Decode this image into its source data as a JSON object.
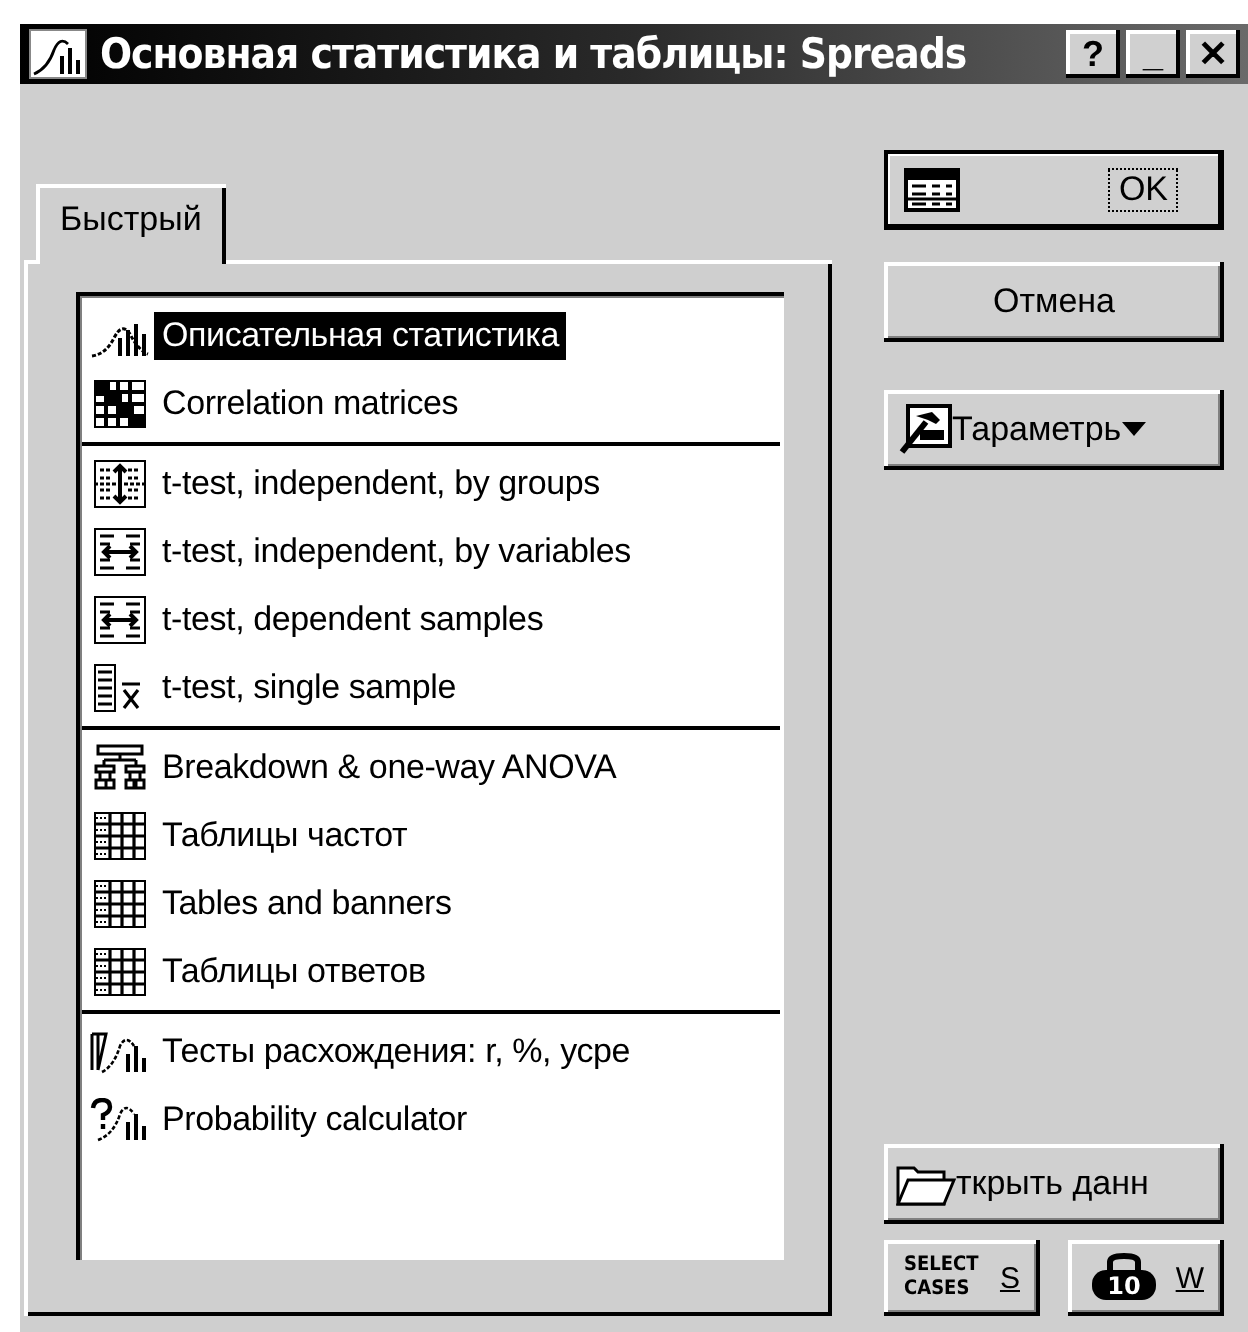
{
  "window": {
    "title": "Основная статистика и таблицы: Spreads",
    "controls": [
      "?",
      "_",
      "✕"
    ]
  },
  "tabs": [
    {
      "label": "Быстрый",
      "selected": true
    }
  ],
  "list_groups": [
    {
      "items": [
        {
          "label": "Описательная статистика",
          "kind": "descriptive",
          "selected": true
        },
        {
          "label": "Correlation matrices",
          "kind": "matrix",
          "selected": false
        }
      ]
    },
    {
      "items": [
        {
          "label": "t-test, independent, by groups",
          "kind": "ttest-groups",
          "selected": false
        },
        {
          "label": "t-test, independent, by variables",
          "kind": "ttest-vars",
          "selected": false
        },
        {
          "label": "t-test, dependent samples",
          "kind": "ttest-vars",
          "selected": false
        },
        {
          "label": "t-test, single sample",
          "kind": "ttest-single",
          "selected": false
        }
      ]
    },
    {
      "items": [
        {
          "label": "Breakdown & one-way ANOVA",
          "kind": "breakdown",
          "selected": false
        },
        {
          "label": "Таблицы частот",
          "kind": "table",
          "selected": false
        },
        {
          "label": "Tables and banners",
          "kind": "table",
          "selected": false
        },
        {
          "label": "Таблицы ответов",
          "kind": "table",
          "selected": false
        }
      ]
    },
    {
      "items": [
        {
          "label": "Тесты расхождения: r, %, усре",
          "kind": "tests",
          "selected": false
        },
        {
          "label": "Probability calculator",
          "kind": "probability",
          "selected": false
        }
      ]
    }
  ],
  "buttons": {
    "ok": "OK",
    "cancel": "Отмена",
    "options": "Тараметрь",
    "open_data": "ткрыть данн",
    "select_cases": {
      "line1": "SELECT",
      "line2": "CASES",
      "key": "S"
    },
    "weight": {
      "badge": "10",
      "key": "W"
    }
  }
}
